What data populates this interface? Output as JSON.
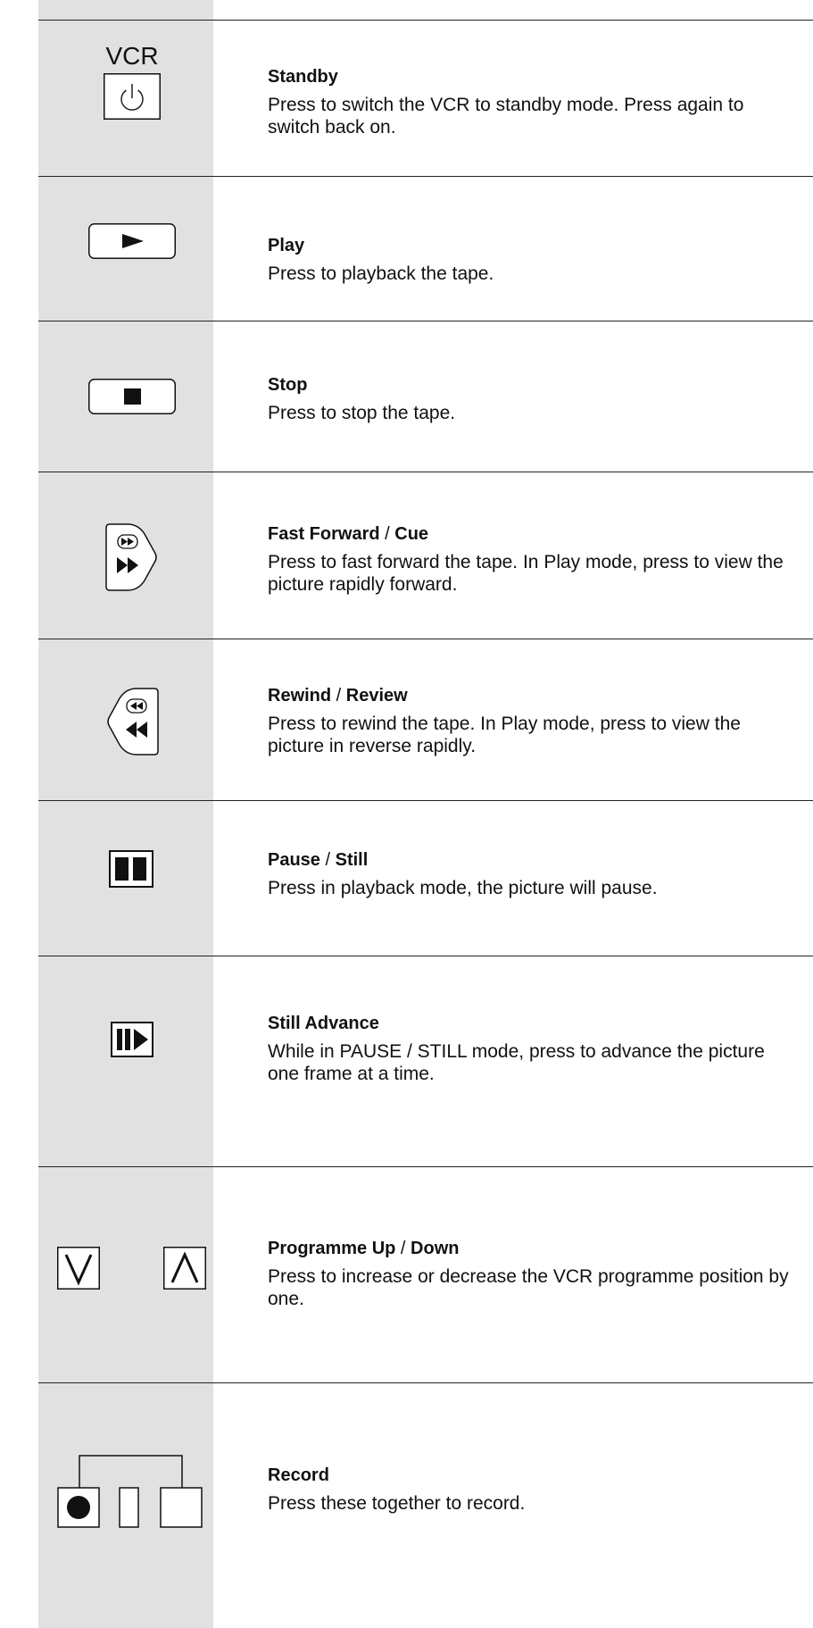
{
  "vcr_label": "VCR",
  "entries": [
    {
      "title": "Standby",
      "description": "Press to switch the VCR to standby mode. Press again to switch back on."
    },
    {
      "title": "Play",
      "description": "Press to playback the tape."
    },
    {
      "title": "Stop",
      "description": "Press to stop the tape."
    },
    {
      "title_a": "Fast Forward",
      "sep": " / ",
      "title_b": "Cue",
      "description": "Press to fast forward the tape. In Play mode, press to view the picture rapidly forward."
    },
    {
      "title_a": "Rewind",
      "sep": " / ",
      "title_b": "Review",
      "description": "Press to rewind the tape. In Play mode, press to view the picture in reverse rapidly."
    },
    {
      "title_a": "Pause",
      "sep": " / ",
      "title_b": "Still",
      "description": "Press in playback mode, the picture will pause."
    },
    {
      "title": "Still Advance",
      "description": "While in PAUSE / STILL mode, press to advance the picture one frame at a time."
    },
    {
      "title_a": "Programme Up",
      "sep": " / ",
      "title_b": "Down",
      "description": "Press to increase or decrease the VCR programme position by one."
    },
    {
      "title": "Record",
      "description": "Press these together to record."
    }
  ],
  "icons": {
    "standby": "power-icon",
    "play": "play-icon",
    "stop": "stop-icon",
    "fast_forward": "fast-forward-icon",
    "rewind": "rewind-icon",
    "pause": "pause-icon",
    "still_advance": "still-advance-icon",
    "programme_down": "programme-down-icon",
    "programme_up": "programme-up-icon",
    "record": "record-icon"
  }
}
